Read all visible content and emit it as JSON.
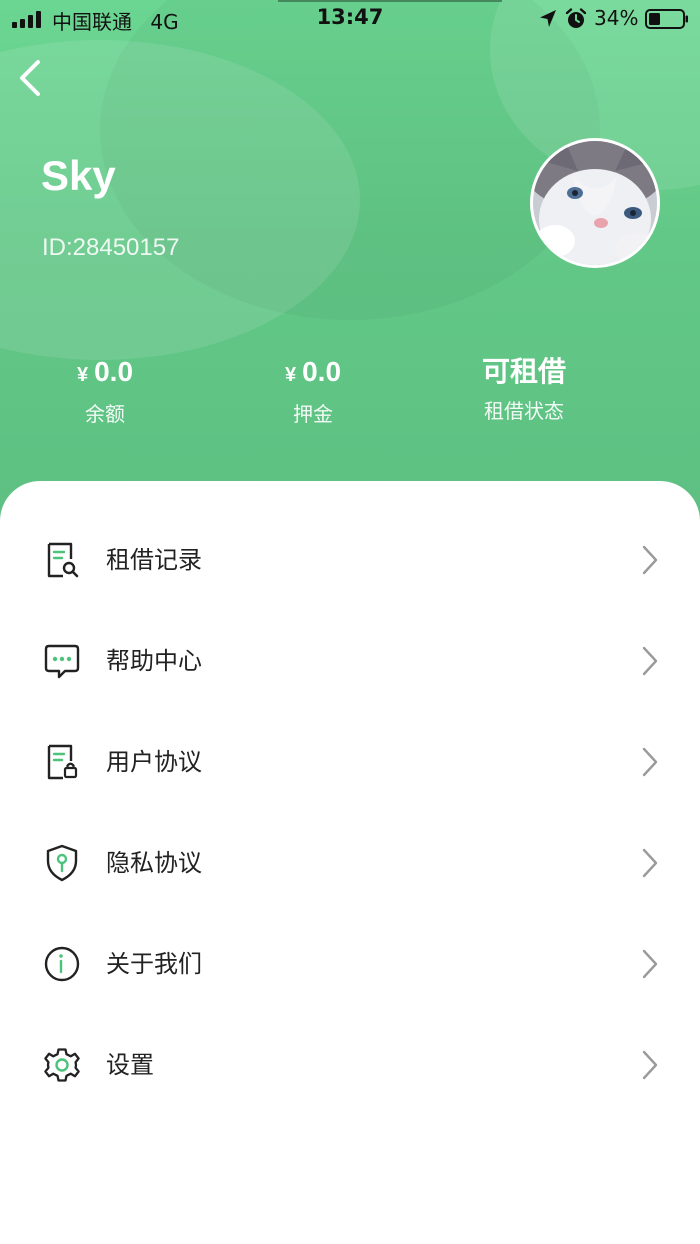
{
  "status_bar": {
    "carrier": "中国联通",
    "network": "4G",
    "time": "13:47",
    "battery": "34%",
    "icons": [
      "signal-icon",
      "location-icon",
      "alarm-icon",
      "battery-icon"
    ]
  },
  "profile": {
    "name": "Sky",
    "id": "ID:28450157"
  },
  "stats": [
    {
      "currency": "¥",
      "value": "0.0",
      "label": "余额"
    },
    {
      "currency": "¥",
      "value": "0.0",
      "label": "押金"
    },
    {
      "value": "可租借",
      "label": "租借状态"
    }
  ],
  "menu": [
    {
      "label": "租借记录",
      "icon": "document-search-icon"
    },
    {
      "label": "帮助中心",
      "icon": "chat-bubble-icon"
    },
    {
      "label": "用户协议",
      "icon": "document-lock-icon"
    },
    {
      "label": "隐私协议",
      "icon": "shield-key-icon"
    },
    {
      "label": "关于我们",
      "icon": "info-icon"
    },
    {
      "label": "设置",
      "icon": "gear-icon"
    }
  ],
  "colors": {
    "header_green": "#62c887",
    "accent_green": "#4cc37a",
    "text_dark": "#222222"
  }
}
